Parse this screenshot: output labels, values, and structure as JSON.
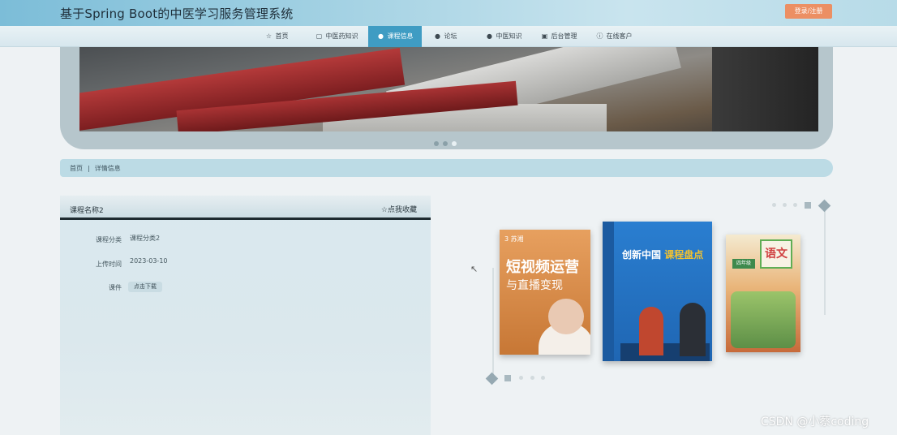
{
  "header": {
    "site_title": "基于Spring Boot的中医学习服务管理系统",
    "login_label": "登录/注册"
  },
  "nav": {
    "items": [
      {
        "label": "首页",
        "icon": "star-icon",
        "active": false
      },
      {
        "label": "中医药知识",
        "icon": "bag-icon",
        "active": false
      },
      {
        "label": "课程信息",
        "icon": "dot-icon",
        "active": true
      },
      {
        "label": "论坛",
        "icon": "dot-icon",
        "active": false
      },
      {
        "label": "中医知识",
        "icon": "dot-icon",
        "active": false
      },
      {
        "label": "后台管理",
        "icon": "calendar-icon",
        "active": false
      },
      {
        "label": "在线客户",
        "icon": "info-icon",
        "active": false
      }
    ]
  },
  "banner": {
    "slide_count": 3,
    "active_slide": 3
  },
  "breadcrumb": {
    "home": "首页",
    "separator": "|",
    "current": "详情信息"
  },
  "details": {
    "course_name": "课程名称2",
    "favorite_label": "☆点我收藏",
    "rows": [
      {
        "label": "课程分类",
        "value": "课程分类2"
      },
      {
        "label": "上传时间",
        "value": "2023-03-10"
      },
      {
        "label": "课件",
        "value": "点击下载"
      }
    ]
  },
  "books": [
    {
      "title_line1": "短视频运营",
      "title_line2": "与直播变现",
      "publisher": "3 苏湘"
    },
    {
      "title_a": "创新中国",
      "title_b": "课程盘点"
    },
    {
      "title": "语文",
      "grade": "四年级"
    }
  ],
  "watermark": "CSDN @小蔡coding"
}
